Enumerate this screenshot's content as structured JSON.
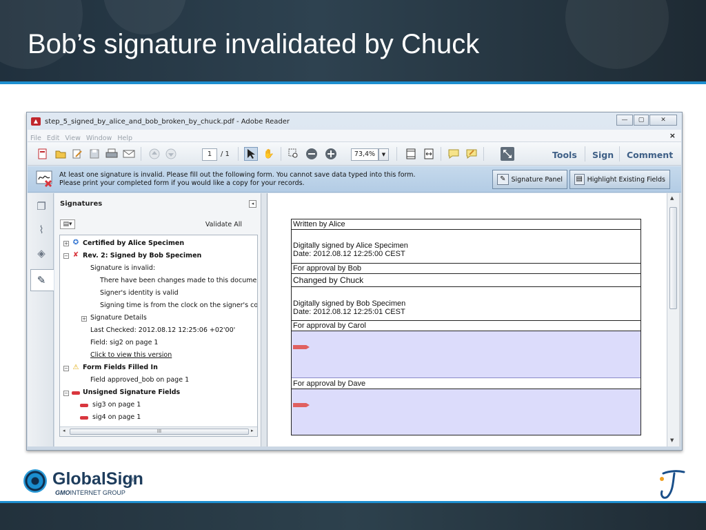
{
  "slide": {
    "title": "Bob’s signature invalidated by Chuck"
  },
  "window": {
    "title": "step_5_signed_by_alice_and_bob_broken_by_chuck.pdf - Adobe Reader",
    "controls": {
      "minimize": "—",
      "maximize": "▢",
      "close": "✕"
    }
  },
  "menubar": {
    "items": [
      "File",
      "Edit",
      "View",
      "Window",
      "Help"
    ],
    "close": "×"
  },
  "toolbar": {
    "page_current": "1",
    "page_total": "/ 1",
    "zoom": "73,4%",
    "tools": "Tools",
    "sign": "Sign",
    "comment": "Comment"
  },
  "message": {
    "line1": "At least one signature is invalid.  Please fill out the following form. You cannot save data typed into this form.",
    "line2": "Please print your completed form if you would like a copy for your records.",
    "signature_panel": "Signature Panel",
    "highlight_fields": "Highlight Existing Fields"
  },
  "signatures_panel": {
    "title": "Signatures",
    "validate_all": "Validate All",
    "tree": {
      "certified": "Certified by Alice Specimen",
      "rev2": "Rev. 2: Signed by Bob Specimen",
      "invalid": "Signature is invalid:",
      "changes": "There have been changes made to this document",
      "identity": "Signer's identity is valid",
      "time": "Signing time is from the clock on the signer's com",
      "details": "Signature Details",
      "last_checked": "Last Checked: 2012.08.12 12:25:06 +02'00'",
      "field": "Field: sig2 on page 1",
      "click_view": "Click to view this version",
      "form_fields": "Form Fields Filled In",
      "field_approved": "Field approved_bob on page 1",
      "unsigned": "Unsigned Signature Fields",
      "sig3": "sig3 on page 1",
      "sig4": "sig4 on page 1"
    },
    "scroll_grip": "III"
  },
  "document": {
    "written_by": "Written by Alice",
    "alice_sig_1": "Digitally signed by Alice Specimen",
    "alice_sig_2": "Date: 2012.08.12 12:25:00 CEST",
    "approval_bob": "For approval by Bob",
    "changed_by": "Changed by Chuck",
    "bob_sig_1": "Digitally signed by Bob Specimen",
    "bob_sig_2": "Date: 2012.08.12 12:25:01 CEST",
    "approval_carol": "For approval by Carol",
    "approval_dave": "For approval by Dave"
  },
  "footer": {
    "brand": "GlobalSign",
    "reg": "®",
    "group_gmo": "GMO",
    "group_rest": "INTERNET GROUP"
  },
  "colors": {
    "accent": "#1e8fd0",
    "header_bg": "#2a3b47",
    "sig_field": "#dcdcfb",
    "invalid_red": "#d9363e"
  },
  "icons": [
    "pdf-icon",
    "create-icon",
    "open-icon",
    "edit-icon",
    "save-icon",
    "print-icon",
    "email-icon",
    "prev-page-icon",
    "next-page-icon",
    "select-icon",
    "hand-icon",
    "marquee-zoom-icon",
    "zoom-out-icon",
    "zoom-in-icon",
    "fit-page-icon",
    "fit-width-icon",
    "comment-icon",
    "highlight-icon",
    "fullscreen-icon",
    "invalid-signature-icon",
    "pages-icon",
    "attachments-icon",
    "layers-icon",
    "signatures-icon",
    "ribbon-icon",
    "warning-icon",
    "pen-icon"
  ]
}
